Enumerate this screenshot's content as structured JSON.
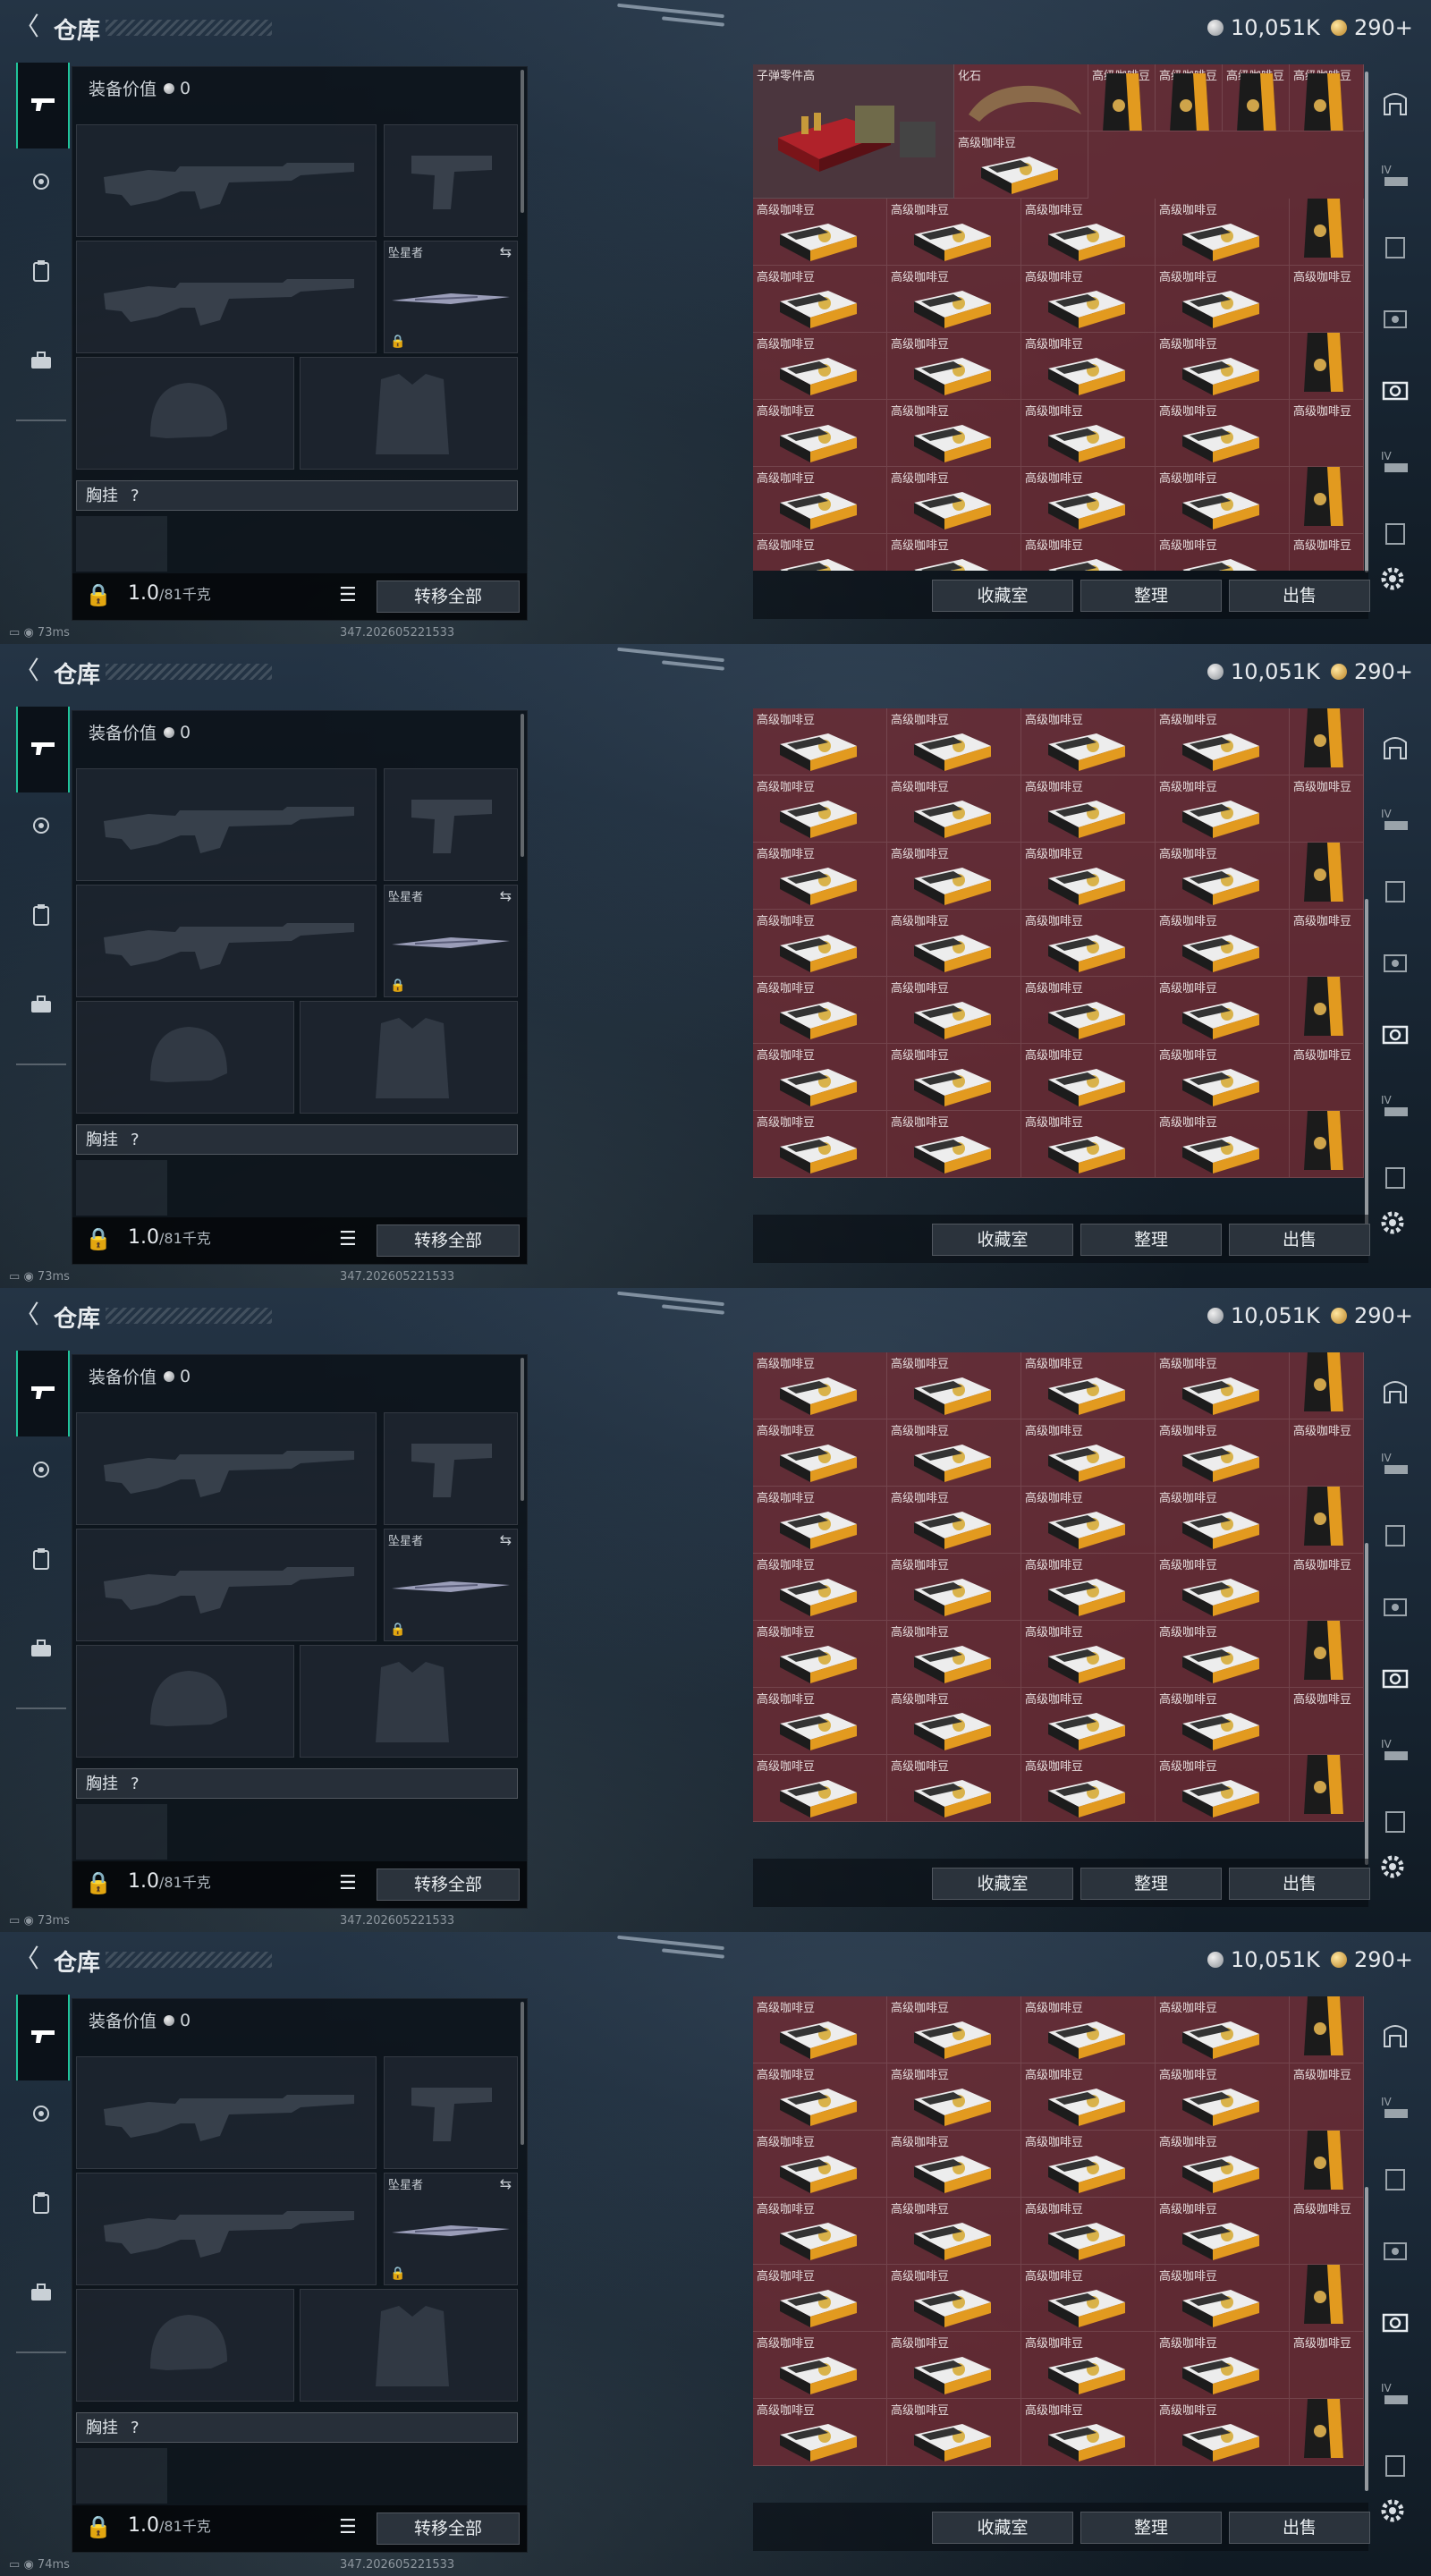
{
  "header": {
    "title": "仓库",
    "silver": "10,051K",
    "gold": "290+"
  },
  "loadout": {
    "value_label": "装备价值",
    "value": "0",
    "melee_name": "坠星者",
    "chest_label": "胸挂",
    "chest_hint": "?",
    "weight": "1.0",
    "weight_max": "/81千克",
    "transfer_all": "转移全部"
  },
  "grid_special": {
    "parts": "子弹零件高",
    "fossil": "化石"
  },
  "coffee_label": "高级咖啡豆",
  "actions": {
    "collection": "收藏室",
    "sort": "整理",
    "sell": "出售"
  },
  "status": [
    {
      "ping": "73ms",
      "version": "347.202605221533"
    },
    {
      "ping": "73ms",
      "version": "347.202605221533"
    },
    {
      "ping": "73ms",
      "version": "347.202605221533"
    },
    {
      "ping": "74ms",
      "version": "347.202605221533"
    }
  ],
  "colors": {
    "accent": "#20c39a",
    "grid": "#6c2c34",
    "gold_box": "#e29a1f"
  }
}
